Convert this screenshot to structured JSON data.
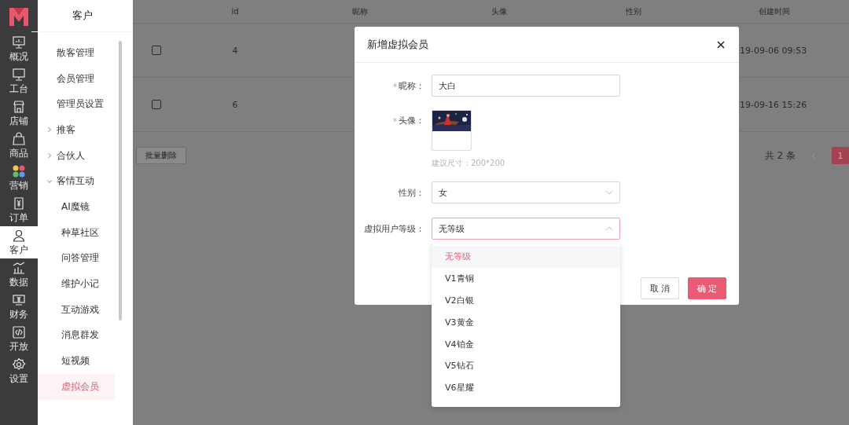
{
  "rail": {
    "items": [
      {
        "kind": "overview",
        "label": "概况",
        "selected": false
      },
      {
        "kind": "desk",
        "label": "工台",
        "selected": false
      },
      {
        "kind": "shop",
        "label": "店铺",
        "selected": false
      },
      {
        "kind": "goods",
        "label": "商品",
        "selected": false
      },
      {
        "kind": "marketing",
        "label": "营销",
        "selected": false
      },
      {
        "kind": "order",
        "label": "订单",
        "selected": false
      },
      {
        "kind": "customer",
        "label": "客户",
        "selected": true
      },
      {
        "kind": "data",
        "label": "数据",
        "selected": false
      },
      {
        "kind": "finance",
        "label": "财务",
        "selected": false
      },
      {
        "kind": "open",
        "label": "开放",
        "selected": false
      },
      {
        "kind": "settings",
        "label": "设置",
        "selected": false
      }
    ]
  },
  "subnav": {
    "title": "客户",
    "items": [
      {
        "label": "散客管理",
        "selected": false
      },
      {
        "label": "会员管理",
        "selected": false
      },
      {
        "label": "管理员设置",
        "selected": false
      },
      {
        "label": "推客",
        "expanded": false
      },
      {
        "label": "合伙人",
        "expanded": false
      },
      {
        "label": "客情互动",
        "expanded": true,
        "children": [
          {
            "label": "AI魔镜",
            "selected": false
          },
          {
            "label": "种草社区",
            "selected": false
          },
          {
            "label": "问答管理",
            "selected": false
          },
          {
            "label": "维护小记",
            "selected": false
          },
          {
            "label": "互动游戏",
            "selected": false
          },
          {
            "label": "消息群发",
            "selected": false
          },
          {
            "label": "短视频",
            "selected": false
          },
          {
            "label": "虚拟会员",
            "selected": true
          }
        ]
      }
    ]
  },
  "table": {
    "columns": [
      "id",
      "昵称",
      "头像",
      "性别",
      "创建时间"
    ],
    "rows": [
      {
        "checked": false,
        "id": "4",
        "created": "19-09-06 09:53"
      },
      {
        "checked": false,
        "id": "6",
        "created": "19-09-16 15:26"
      }
    ]
  },
  "batch_delete": "批量删除",
  "pagination": {
    "total": "共 2 条",
    "pages": [
      {
        "label": "1",
        "selected": true
      }
    ]
  },
  "modal": {
    "title": "新增虚拟会员",
    "fields": [
      {
        "kind": "text",
        "label": "昵称：",
        "required": true,
        "value": "大白"
      },
      {
        "label": "头像：",
        "required": true,
        "hint": "建议尺寸：200*200"
      },
      {
        "kind": "select",
        "label": "性别：",
        "required": false,
        "value": "女",
        "open": false
      },
      {
        "kind": "select",
        "label": "虚拟用户等级：",
        "required": false,
        "value": "无等级",
        "open": true,
        "options": [
          {
            "label": "无等级",
            "selected": true
          },
          {
            "label": "V1青铜",
            "selected": false
          },
          {
            "label": "V2白银",
            "selected": false
          },
          {
            "label": "V3黄金",
            "selected": false
          },
          {
            "label": "V4铂金",
            "selected": false
          },
          {
            "label": "V5钻石",
            "selected": false
          },
          {
            "label": "V6星耀",
            "selected": false
          }
        ]
      }
    ],
    "buttons": [
      {
        "kind": "default",
        "label": "取 消"
      },
      {
        "kind": "primary",
        "label": "确 定"
      }
    ]
  }
}
